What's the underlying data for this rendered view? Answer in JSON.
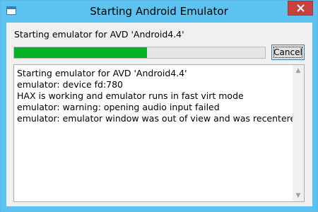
{
  "window": {
    "title": "Starting Android Emulator",
    "accent_color": "#5cc3f0",
    "close_button_color": "#c7423e"
  },
  "status": {
    "label": "Starting emulator for AVD 'Android4.4'"
  },
  "progress": {
    "fraction": 0.53,
    "color": "#06b025"
  },
  "buttons": {
    "cancel_label": "Cancel"
  },
  "log": {
    "lines": [
      "Starting emulator for AVD 'Android4.4'",
      "emulator: device fd:780",
      "HAX is working and emulator runs in fast virt mode",
      "emulator: warning: opening audio input failed",
      "emulator: emulator window was out of view and was recentered"
    ]
  },
  "icons": {
    "app": "window-icon",
    "close": "close-icon",
    "scroll_up": "scroll-up-arrow-icon",
    "scroll_down": "scroll-down-arrow-icon"
  }
}
